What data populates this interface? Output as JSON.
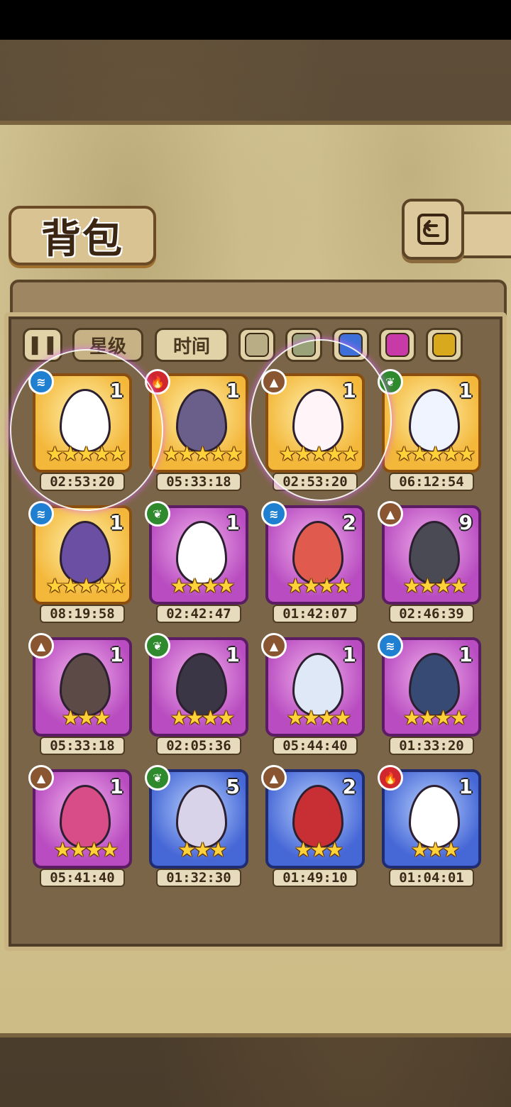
{
  "header": {
    "title": "背包"
  },
  "filters": {
    "pause_icon": "pause-icon",
    "star_label": "星级",
    "time_label": "时间",
    "colors": [
      "#b9ad86",
      "#9aa27a",
      "#3e6fd8",
      "#c83aa8",
      "#d8a91c"
    ]
  },
  "items": [
    {
      "element": "water",
      "frame": "gold",
      "count": "1",
      "stars": "★★★★★",
      "timer": "02:53:20",
      "egg": "#ffffff"
    },
    {
      "element": "fire",
      "frame": "gold",
      "count": "1",
      "stars": "★★★★★",
      "timer": "05:33:18",
      "egg": "#6a5f8a"
    },
    {
      "element": "earth",
      "frame": "gold",
      "count": "1",
      "stars": "★★★★★",
      "timer": "02:53:20",
      "egg": "#fff5f8"
    },
    {
      "element": "grass",
      "frame": "gold",
      "count": "1",
      "stars": "★★★★★",
      "timer": "06:12:54",
      "egg": "#f0f4ff"
    },
    {
      "element": "water",
      "frame": "gold",
      "count": "1",
      "stars": "★★★★★",
      "timer": "08:19:58",
      "egg": "#6b4fa3"
    },
    {
      "element": "grass",
      "frame": "purple",
      "count": "1",
      "stars": "★★★★",
      "timer": "02:42:47",
      "egg": "#ffffff"
    },
    {
      "element": "water",
      "frame": "purple",
      "count": "2",
      "stars": "★★★★",
      "timer": "01:42:07",
      "egg": "#e05a4e"
    },
    {
      "element": "earth",
      "frame": "purple",
      "count": "9",
      "stars": "★★★★",
      "timer": "02:46:39",
      "egg": "#4a4a55"
    },
    {
      "element": "earth",
      "frame": "purple",
      "count": "1",
      "stars": "★★★",
      "timer": "05:33:18",
      "egg": "#5b4a45"
    },
    {
      "element": "grass",
      "frame": "purple",
      "count": "1",
      "stars": "★★★★",
      "timer": "02:05:36",
      "egg": "#3a3645"
    },
    {
      "element": "earth",
      "frame": "purple",
      "count": "1",
      "stars": "★★★★",
      "timer": "05:44:40",
      "egg": "#dfe8f6"
    },
    {
      "element": "water",
      "frame": "purple",
      "count": "1",
      "stars": "★★★★",
      "timer": "01:33:20",
      "egg": "#364a73"
    },
    {
      "element": "earth",
      "frame": "purple",
      "count": "1",
      "stars": "★★★★",
      "timer": "05:41:40",
      "egg": "#d84d88"
    },
    {
      "element": "grass",
      "frame": "blue",
      "count": "5",
      "stars": "★★★",
      "timer": "01:32:30",
      "egg": "#d9d3ea"
    },
    {
      "element": "earth",
      "frame": "blue",
      "count": "2",
      "stars": "★★★",
      "timer": "01:49:10",
      "egg": "#c72f35"
    },
    {
      "element": "fire",
      "frame": "blue",
      "count": "1",
      "stars": "★★★",
      "timer": "01:04:01",
      "egg": "#ffffff"
    }
  ]
}
